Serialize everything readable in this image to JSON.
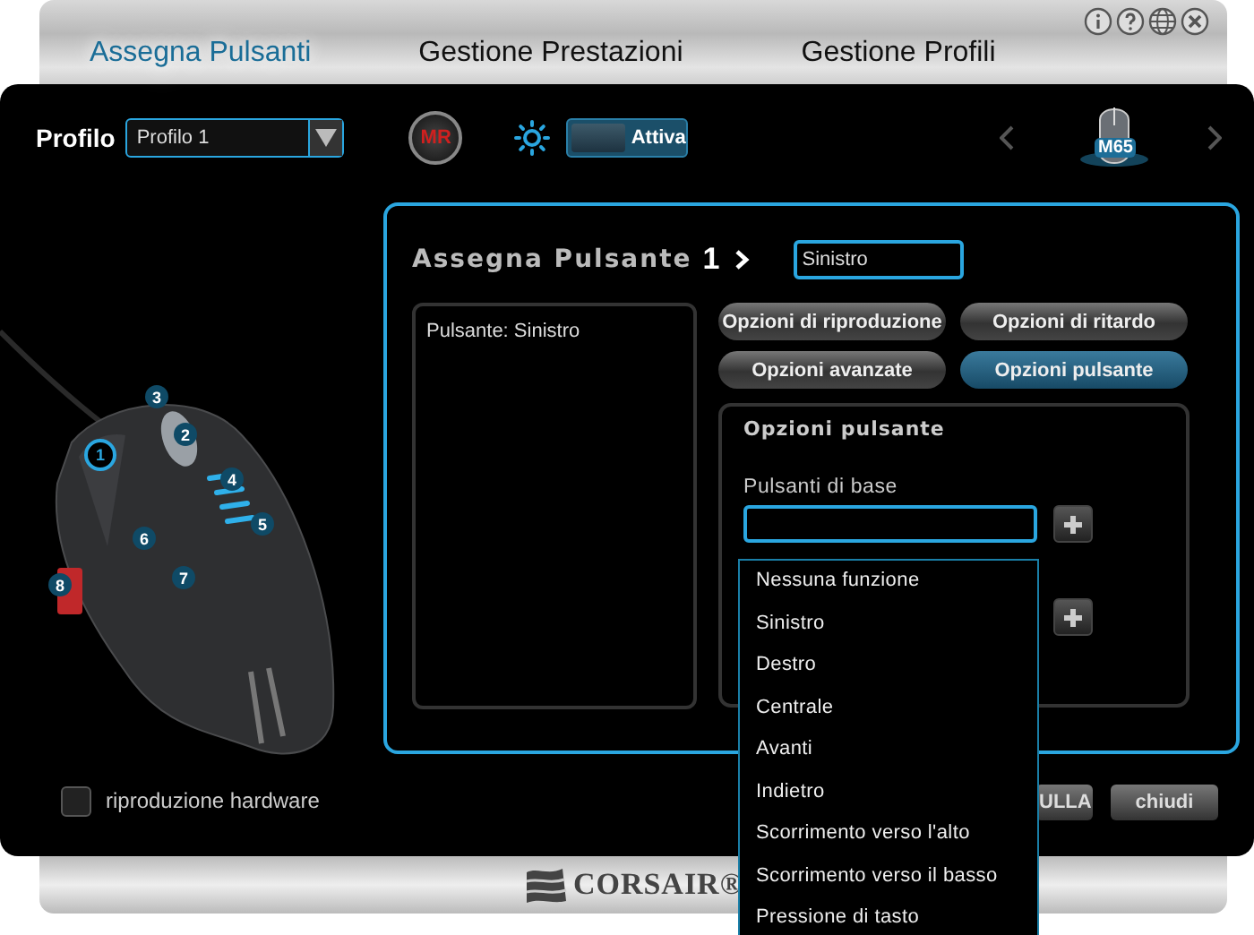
{
  "tabs": [
    {
      "label": "Assegna Pulsanti",
      "selected": true
    },
    {
      "label": "Gestione Prestazioni",
      "selected": false
    },
    {
      "label": "Gestione Profili",
      "selected": false
    }
  ],
  "toolbar": {
    "profile_label": "Profilo",
    "profile_select": {
      "value": "Profilo 1"
    },
    "macro_record": {
      "label": "MR"
    },
    "lighting_toggle": {
      "label": "Attiva",
      "on": true
    },
    "device": {
      "label": "M65"
    }
  },
  "mouse_callouts": [
    {
      "label": "1",
      "selected": true
    },
    {
      "label": "2",
      "selected": false
    },
    {
      "label": "3",
      "selected": false
    },
    {
      "label": "4",
      "selected": false
    },
    {
      "label": "5",
      "selected": false
    },
    {
      "label": "6",
      "selected": false
    },
    {
      "label": "7",
      "selected": false
    },
    {
      "label": "8",
      "selected": false
    }
  ],
  "hardware_playback": {
    "label": "riproduzione hardware",
    "checked": false
  },
  "assign_panel": {
    "title": "Assegna Pulsante",
    "button_number": "1",
    "name_field": {
      "value": "Sinistro"
    },
    "summary": "Pulsante: Sinistro",
    "option_tabs": [
      {
        "label": "Opzioni di riproduzione",
        "selected": false
      },
      {
        "label": "Opzioni di ritardo",
        "selected": false
      },
      {
        "label": "Opzioni avanzate",
        "selected": false
      },
      {
        "label": "Opzioni pulsante",
        "selected": true
      }
    ],
    "options_title": "Opzioni pulsante",
    "basic_label": "Pulsanti di base",
    "basic_dropdown": {
      "expanded": true,
      "options": [
        "Nessuna funzione",
        "Sinistro",
        "Destro",
        "Centrale",
        "Avanti",
        "Indietro",
        "Scorrimento verso l'alto",
        "Scorrimento verso il basso",
        "Pressione di tasto"
      ]
    }
  },
  "actions": [
    {
      "label": "ULLA"
    },
    {
      "label": "chiudi"
    }
  ],
  "footer": {
    "brand": "CORSAIR®"
  }
}
